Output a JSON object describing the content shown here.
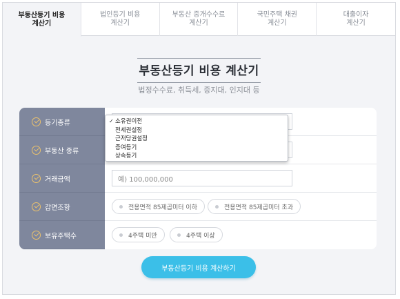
{
  "tabs": [
    {
      "label": "부동산등기 비용\n계산기",
      "active": true
    },
    {
      "label": "법인등기 비용\n계산기",
      "active": false
    },
    {
      "label": "부동산 중개수수료\n계산기",
      "active": false
    },
    {
      "label": "국민주택 채권\n계산기",
      "active": false
    },
    {
      "label": "대출이자\n계산기",
      "active": false
    }
  ],
  "header": {
    "title": "부동산등기 비용 계산기",
    "subtitle": "법정수수료, 취득세, 증지대, 인지대 등"
  },
  "form": {
    "rows": [
      {
        "label": "등기종류"
      },
      {
        "label": "부동산 종류"
      },
      {
        "label": "거래금액"
      },
      {
        "label": "감면조항"
      },
      {
        "label": "보유주택수"
      }
    ],
    "amount_placeholder": "예) 100,000,000",
    "reduction_options": [
      "전용면적 85제곱미터 이하",
      "전용면적 85제곱미터 초과"
    ],
    "house_count_options": [
      "4주택 미만",
      "4주택 이상"
    ]
  },
  "dropdown": {
    "selected_mark": "✓",
    "options": [
      "소유권이전",
      "전세권설정",
      "근저당권설정",
      "증여등기",
      "상속등기"
    ],
    "selected_index": 0
  },
  "submit_label": "부동산등기 비용 계산하기",
  "colors": {
    "label_bg": "#7f879d",
    "check_accent": "#f0c46a",
    "submit_bg": "#3bbfe8"
  }
}
